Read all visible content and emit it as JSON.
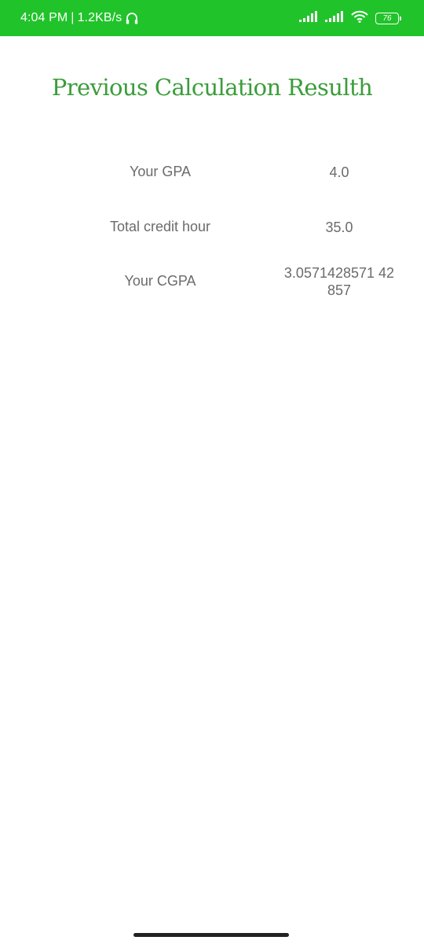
{
  "status_bar": {
    "time": "4:04 PM",
    "separator": "|",
    "speed": "1.2KB/s",
    "battery": "76",
    "bg_color": "#21c32a"
  },
  "page": {
    "title": "Previous Calculation Resulth",
    "title_color": "#3a9d3a"
  },
  "results": [
    {
      "label": "Your GPA",
      "value": "4.0"
    },
    {
      "label": "Total credit hour",
      "value": "35.0"
    },
    {
      "label": "Your CGPA",
      "value": "3.0571428571 42857"
    }
  ]
}
